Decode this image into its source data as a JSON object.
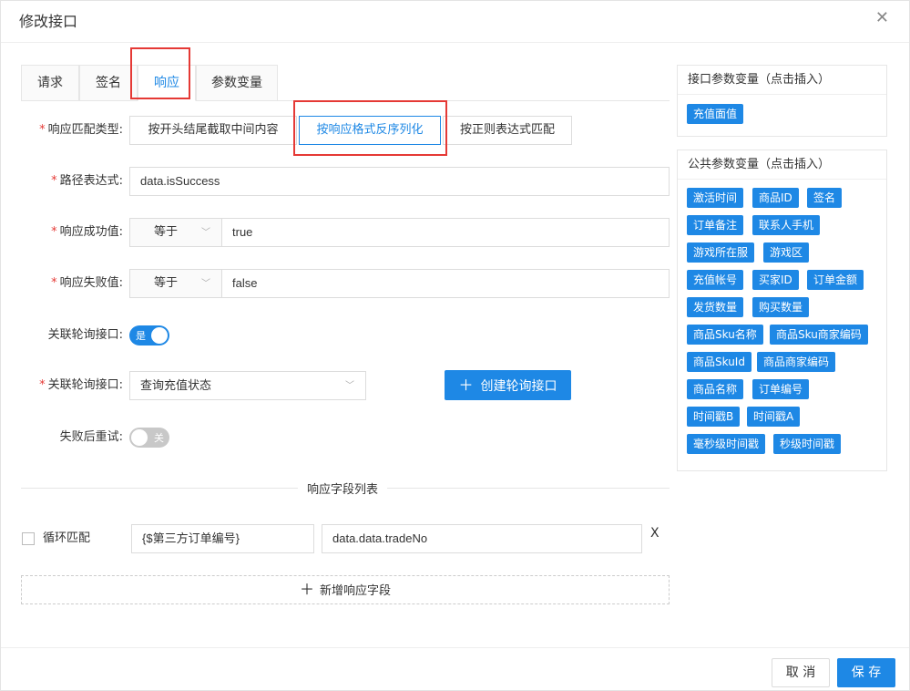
{
  "dialog": {
    "title": "修改接口"
  },
  "tabs": [
    {
      "label": "请求"
    },
    {
      "label": "签名"
    },
    {
      "label": "响应"
    },
    {
      "label": "参数变量"
    }
  ],
  "form": {
    "match_type": {
      "label": "响应匹配类型:",
      "options": [
        "按开头结尾截取中间内容",
        "按响应格式反序列化",
        "按正则表达式匹配"
      ],
      "selected": "按响应格式反序列化"
    },
    "path": {
      "label": "路径表达式:",
      "value": "data.isSuccess"
    },
    "success": {
      "label": "响应成功值:",
      "op": "等于",
      "value": "true"
    },
    "fail": {
      "label": "响应失败值:",
      "op": "等于",
      "value": "false"
    },
    "poll_toggle": {
      "label": "关联轮询接口:",
      "state_text": "是",
      "on": true
    },
    "poll_select": {
      "label": "关联轮询接口:",
      "value": "查询充值状态"
    },
    "create_poll_button": "创建轮询接口",
    "retry": {
      "label": "失败后重试:",
      "state_text": "关",
      "on": false
    }
  },
  "fields_section": {
    "title": "响应字段列表",
    "rows": [
      {
        "loop_label": "循环匹配",
        "name": "{$第三方订单编号}",
        "path": "data.data.tradeNo",
        "remove": "X"
      }
    ],
    "add_label": "新增响应字段"
  },
  "interface_vars": {
    "title": "接口参数变量（点击插入）",
    "chips": [
      "充值面值"
    ]
  },
  "public_vars": {
    "title": "公共参数变量（点击插入）",
    "chips": [
      "激活时间",
      "商品ID",
      "签名",
      "订单备注",
      "联系人手机",
      "游戏所在服",
      "游戏区",
      "充值帐号",
      "买家ID",
      "订单金额",
      "发货数量",
      "购买数量",
      "商品Sku名称",
      "商品Sku商家编码",
      "商品SkuId",
      "商品商家编码",
      "商品名称",
      "订单编号",
      "时间戳B",
      "时间戳A",
      "毫秒级时间戳",
      "秒级时间戳"
    ]
  },
  "footer": {
    "cancel": "取 消",
    "save": "保 存"
  },
  "colors": {
    "primary": "#1e88e5",
    "highlight": "#e53935"
  },
  "icons": {
    "close": "close-icon",
    "chevron": "chevron-down-icon",
    "plus": "plus-icon"
  }
}
